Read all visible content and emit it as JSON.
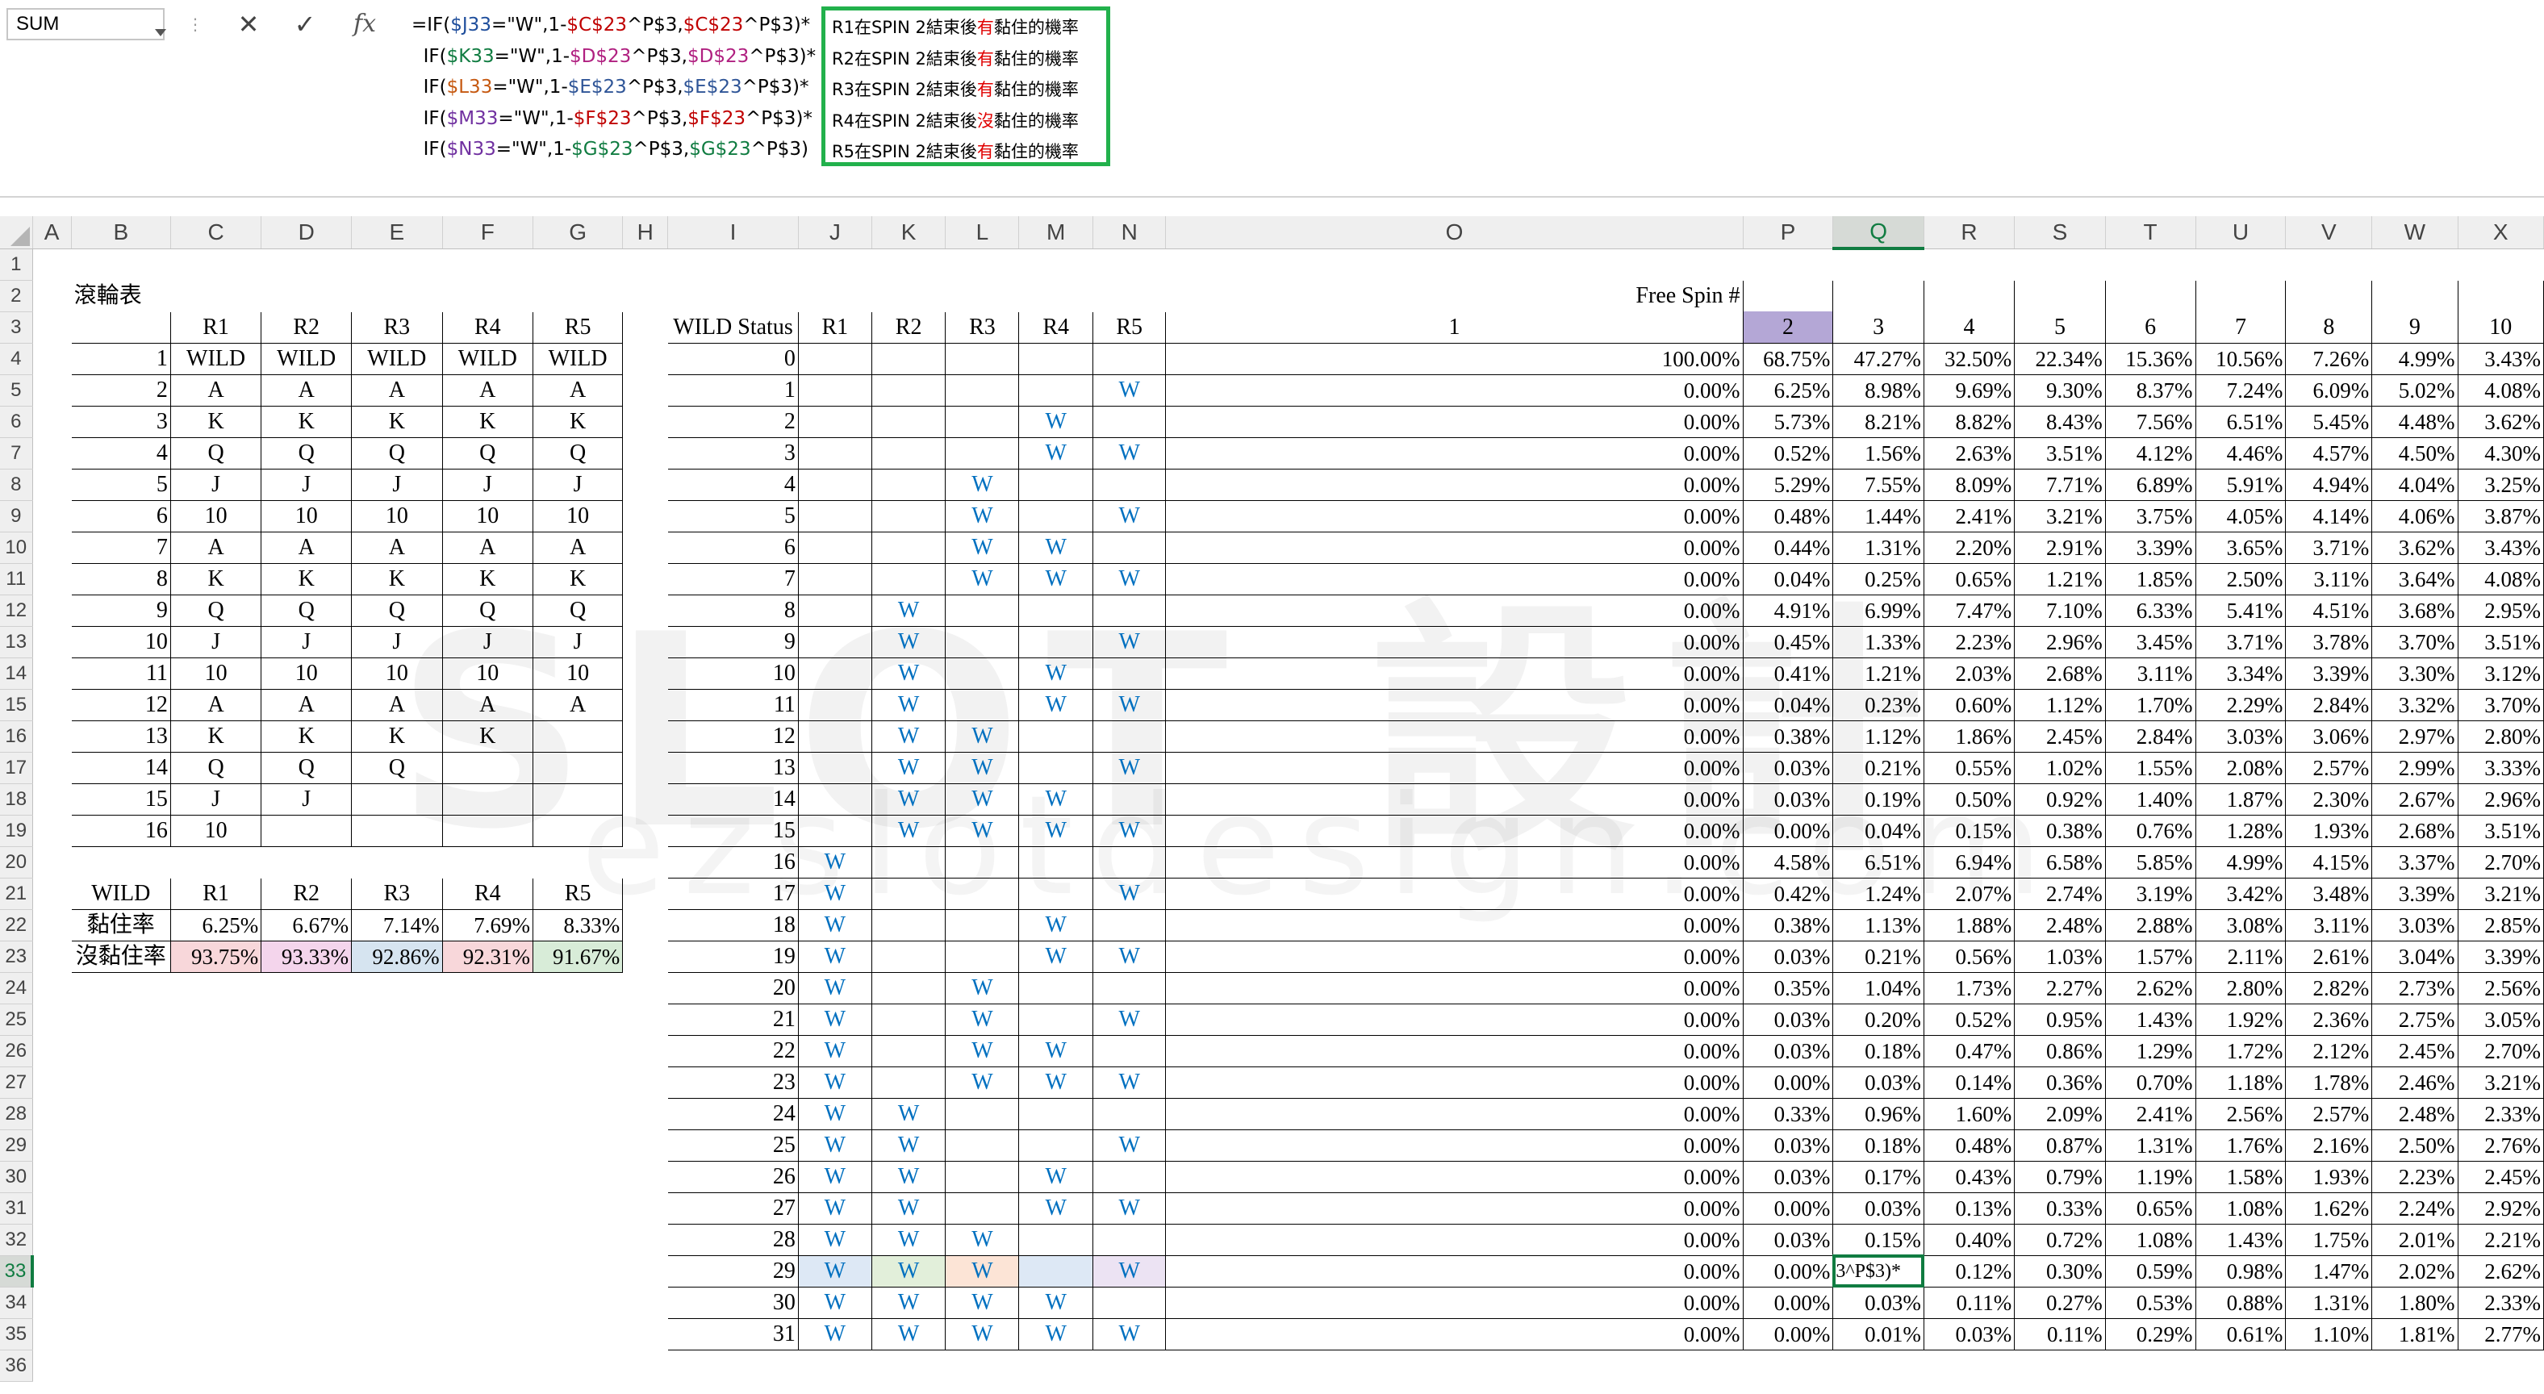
{
  "name_box": "SUM",
  "formula_bar": {
    "cancel_icon": "✕",
    "enter_icon": "✓",
    "fx_label": "fx",
    "lines": [
      [
        [
          "=IF(",
          "#000"
        ],
        [
          "$J33",
          "#1f4e9c"
        ],
        [
          "=\"W\",1-",
          "#000"
        ],
        [
          "$C$23",
          "#c00000"
        ],
        [
          "^P$3,",
          "#000"
        ],
        [
          "$C$23",
          "#c00000"
        ],
        [
          "^P$3)*",
          "#000"
        ]
      ],
      [
        [
          "  IF(",
          "#000"
        ],
        [
          "$K33",
          "#107c41"
        ],
        [
          "=\"W\",1-",
          "#000"
        ],
        [
          "$D$23",
          "#b02080"
        ],
        [
          "^P$3,",
          "#000"
        ],
        [
          "$D$23",
          "#b02080"
        ],
        [
          "^P$3)*",
          "#000"
        ]
      ],
      [
        [
          "  IF(",
          "#000"
        ],
        [
          "$L33",
          "#c65911"
        ],
        [
          "=\"W\",1-",
          "#000"
        ],
        [
          "$E$23",
          "#2f5597"
        ],
        [
          "^P$3,",
          "#000"
        ],
        [
          "$E$23",
          "#2f5597"
        ],
        [
          "^P$3)*",
          "#000"
        ]
      ],
      [
        [
          "  IF(",
          "#000"
        ],
        [
          "$M33",
          "#7030a0"
        ],
        [
          "=\"W\",1-",
          "#000"
        ],
        [
          "$F$23",
          "#c00000"
        ],
        [
          "^P$3,",
          "#000"
        ],
        [
          "$F$23",
          "#c00000"
        ],
        [
          "^P$3)*",
          "#000"
        ]
      ],
      [
        [
          "  IF(",
          "#000"
        ],
        [
          "$N33",
          "#7030a0"
        ],
        [
          "=\"W\",1-",
          "#000"
        ],
        [
          "$G$23",
          "#107c41"
        ],
        [
          "^P$3,",
          "#000"
        ],
        [
          "$G$23",
          "#107c41"
        ],
        [
          "^P$3)",
          "#000"
        ]
      ]
    ],
    "notes": [
      {
        "pre": "R1在SPIN 2結束後",
        "hl": "有",
        "post": "黏住的機率"
      },
      {
        "pre": "R2在SPIN 2結束後",
        "hl": "有",
        "post": "黏住的機率"
      },
      {
        "pre": "R3在SPIN 2結束後",
        "hl": "有",
        "post": "黏住的機率"
      },
      {
        "pre": "R4在SPIN 2結束後",
        "hl": "沒",
        "post": "黏住的機率"
      },
      {
        "pre": "R5在SPIN 2結束後",
        "hl": "有",
        "post": "黏住的機率"
      }
    ]
  },
  "columns": [
    "A",
    "B",
    "C",
    "D",
    "E",
    "F",
    "G",
    "H",
    "I",
    "J",
    "K",
    "L",
    "M",
    "N",
    "O",
    "P",
    "Q",
    "R",
    "S",
    "T",
    "U",
    "V",
    "W",
    "X"
  ],
  "selected_column": "Q",
  "selected_row": 33,
  "reel_table": {
    "title": "滾輪表",
    "headers": [
      "R1",
      "R2",
      "R3",
      "R4",
      "R5"
    ],
    "rows": [
      [
        "1",
        "WILD",
        "WILD",
        "WILD",
        "WILD",
        "WILD"
      ],
      [
        "2",
        "A",
        "A",
        "A",
        "A",
        "A"
      ],
      [
        "3",
        "K",
        "K",
        "K",
        "K",
        "K"
      ],
      [
        "4",
        "Q",
        "Q",
        "Q",
        "Q",
        "Q"
      ],
      [
        "5",
        "J",
        "J",
        "J",
        "J",
        "J"
      ],
      [
        "6",
        "10",
        "10",
        "10",
        "10",
        "10"
      ],
      [
        "7",
        "A",
        "A",
        "A",
        "A",
        "A"
      ],
      [
        "8",
        "K",
        "K",
        "K",
        "K",
        "K"
      ],
      [
        "9",
        "Q",
        "Q",
        "Q",
        "Q",
        "Q"
      ],
      [
        "10",
        "J",
        "J",
        "J",
        "J",
        "J"
      ],
      [
        "11",
        "10",
        "10",
        "10",
        "10",
        "10"
      ],
      [
        "12",
        "A",
        "A",
        "A",
        "A",
        "A"
      ],
      [
        "13",
        "K",
        "K",
        "K",
        "K",
        ""
      ],
      [
        "14",
        "Q",
        "Q",
        "Q",
        "",
        ""
      ],
      [
        "15",
        "J",
        "J",
        "",
        "",
        ""
      ],
      [
        "16",
        "10",
        "",
        "",
        "",
        ""
      ]
    ]
  },
  "wild_table": {
    "headers": [
      "WILD",
      "R1",
      "R2",
      "R3",
      "R4",
      "R5"
    ],
    "sticky_label": "黏住率",
    "sticky": [
      "6.25%",
      "6.67%",
      "7.14%",
      "7.69%",
      "8.33%"
    ],
    "not_sticky_label": "沒黏住率",
    "not_sticky": [
      "93.75%",
      "93.33%",
      "92.86%",
      "92.31%",
      "91.67%"
    ],
    "not_sticky_colors": [
      "#f8d7da",
      "#f4d5ec",
      "#d6e4f0",
      "#f8d7da",
      "#d8ecd8"
    ]
  },
  "wild_status": {
    "header": "WILD Status",
    "reel_headers": [
      "R1",
      "R2",
      "R3",
      "R4",
      "R5"
    ],
    "free_spin_title": "Free Spin #",
    "spins": [
      "1",
      "2",
      "3",
      "4",
      "5",
      "6",
      "7",
      "8",
      "9",
      "10"
    ],
    "selected_spin": "2",
    "row33_colors": [
      "#dde8f5",
      "#e2efda",
      "#fce4d6",
      "#dde8f5",
      "#ece3f3"
    ],
    "editing_text": "3^P$3)*",
    "rows": [
      [
        "0",
        "",
        "",
        "",
        "",
        "",
        "100.00%",
        "68.75%",
        "47.27%",
        "32.50%",
        "22.34%",
        "15.36%",
        "10.56%",
        "7.26%",
        "4.99%",
        "3.43%"
      ],
      [
        "1",
        "",
        "",
        "",
        "",
        "W",
        "0.00%",
        "6.25%",
        "8.98%",
        "9.69%",
        "9.30%",
        "8.37%",
        "7.24%",
        "6.09%",
        "5.02%",
        "4.08%"
      ],
      [
        "2",
        "",
        "",
        "",
        "W",
        "",
        "0.00%",
        "5.73%",
        "8.21%",
        "8.82%",
        "8.43%",
        "7.56%",
        "6.51%",
        "5.45%",
        "4.48%",
        "3.62%"
      ],
      [
        "3",
        "",
        "",
        "",
        "W",
        "W",
        "0.00%",
        "0.52%",
        "1.56%",
        "2.63%",
        "3.51%",
        "4.12%",
        "4.46%",
        "4.57%",
        "4.50%",
        "4.30%"
      ],
      [
        "4",
        "",
        "",
        "W",
        "",
        "",
        "0.00%",
        "5.29%",
        "7.55%",
        "8.09%",
        "7.71%",
        "6.89%",
        "5.91%",
        "4.94%",
        "4.04%",
        "3.25%"
      ],
      [
        "5",
        "",
        "",
        "W",
        "",
        "W",
        "0.00%",
        "0.48%",
        "1.44%",
        "2.41%",
        "3.21%",
        "3.75%",
        "4.05%",
        "4.14%",
        "4.06%",
        "3.87%"
      ],
      [
        "6",
        "",
        "",
        "W",
        "W",
        "",
        "0.00%",
        "0.44%",
        "1.31%",
        "2.20%",
        "2.91%",
        "3.39%",
        "3.65%",
        "3.71%",
        "3.62%",
        "3.43%"
      ],
      [
        "7",
        "",
        "",
        "W",
        "W",
        "W",
        "0.00%",
        "0.04%",
        "0.25%",
        "0.65%",
        "1.21%",
        "1.85%",
        "2.50%",
        "3.11%",
        "3.64%",
        "4.08%"
      ],
      [
        "8",
        "",
        "W",
        "",
        "",
        "",
        "0.00%",
        "4.91%",
        "6.99%",
        "7.47%",
        "7.10%",
        "6.33%",
        "5.41%",
        "4.51%",
        "3.68%",
        "2.95%"
      ],
      [
        "9",
        "",
        "W",
        "",
        "",
        "W",
        "0.00%",
        "0.45%",
        "1.33%",
        "2.23%",
        "2.96%",
        "3.45%",
        "3.71%",
        "3.78%",
        "3.70%",
        "3.51%"
      ],
      [
        "10",
        "",
        "W",
        "",
        "W",
        "",
        "0.00%",
        "0.41%",
        "1.21%",
        "2.03%",
        "2.68%",
        "3.11%",
        "3.34%",
        "3.39%",
        "3.30%",
        "3.12%"
      ],
      [
        "11",
        "",
        "W",
        "",
        "W",
        "W",
        "0.00%",
        "0.04%",
        "0.23%",
        "0.60%",
        "1.12%",
        "1.70%",
        "2.29%",
        "2.84%",
        "3.32%",
        "3.70%"
      ],
      [
        "12",
        "",
        "W",
        "W",
        "",
        "",
        "0.00%",
        "0.38%",
        "1.12%",
        "1.86%",
        "2.45%",
        "2.84%",
        "3.03%",
        "3.06%",
        "2.97%",
        "2.80%"
      ],
      [
        "13",
        "",
        "W",
        "W",
        "",
        "W",
        "0.00%",
        "0.03%",
        "0.21%",
        "0.55%",
        "1.02%",
        "1.55%",
        "2.08%",
        "2.57%",
        "2.99%",
        "3.33%"
      ],
      [
        "14",
        "",
        "W",
        "W",
        "W",
        "",
        "0.00%",
        "0.03%",
        "0.19%",
        "0.50%",
        "0.92%",
        "1.40%",
        "1.87%",
        "2.30%",
        "2.67%",
        "2.96%"
      ],
      [
        "15",
        "",
        "W",
        "W",
        "W",
        "W",
        "0.00%",
        "0.00%",
        "0.04%",
        "0.15%",
        "0.38%",
        "0.76%",
        "1.28%",
        "1.93%",
        "2.68%",
        "3.51%"
      ],
      [
        "16",
        "W",
        "",
        "",
        "",
        "",
        "0.00%",
        "4.58%",
        "6.51%",
        "6.94%",
        "6.58%",
        "5.85%",
        "4.99%",
        "4.15%",
        "3.37%",
        "2.70%"
      ],
      [
        "17",
        "W",
        "",
        "",
        "",
        "W",
        "0.00%",
        "0.42%",
        "1.24%",
        "2.07%",
        "2.74%",
        "3.19%",
        "3.42%",
        "3.48%",
        "3.39%",
        "3.21%"
      ],
      [
        "18",
        "W",
        "",
        "",
        "W",
        "",
        "0.00%",
        "0.38%",
        "1.13%",
        "1.88%",
        "2.48%",
        "2.88%",
        "3.08%",
        "3.11%",
        "3.03%",
        "2.85%"
      ],
      [
        "19",
        "W",
        "",
        "",
        "W",
        "W",
        "0.00%",
        "0.03%",
        "0.21%",
        "0.56%",
        "1.03%",
        "1.57%",
        "2.11%",
        "2.61%",
        "3.04%",
        "3.39%"
      ],
      [
        "20",
        "W",
        "",
        "W",
        "",
        "",
        "0.00%",
        "0.35%",
        "1.04%",
        "1.73%",
        "2.27%",
        "2.62%",
        "2.80%",
        "2.82%",
        "2.73%",
        "2.56%"
      ],
      [
        "21",
        "W",
        "",
        "W",
        "",
        "W",
        "0.00%",
        "0.03%",
        "0.20%",
        "0.52%",
        "0.95%",
        "1.43%",
        "1.92%",
        "2.36%",
        "2.75%",
        "3.05%"
      ],
      [
        "22",
        "W",
        "",
        "W",
        "W",
        "",
        "0.00%",
        "0.03%",
        "0.18%",
        "0.47%",
        "0.86%",
        "1.29%",
        "1.72%",
        "2.12%",
        "2.45%",
        "2.70%"
      ],
      [
        "23",
        "W",
        "",
        "W",
        "W",
        "W",
        "0.00%",
        "0.00%",
        "0.03%",
        "0.14%",
        "0.36%",
        "0.70%",
        "1.18%",
        "1.78%",
        "2.46%",
        "3.21%"
      ],
      [
        "24",
        "W",
        "W",
        "",
        "",
        "",
        "0.00%",
        "0.33%",
        "0.96%",
        "1.60%",
        "2.09%",
        "2.41%",
        "2.56%",
        "2.57%",
        "2.48%",
        "2.33%"
      ],
      [
        "25",
        "W",
        "W",
        "",
        "",
        "W",
        "0.00%",
        "0.03%",
        "0.18%",
        "0.48%",
        "0.87%",
        "1.31%",
        "1.76%",
        "2.16%",
        "2.50%",
        "2.76%"
      ],
      [
        "26",
        "W",
        "W",
        "",
        "W",
        "",
        "0.00%",
        "0.03%",
        "0.17%",
        "0.43%",
        "0.79%",
        "1.19%",
        "1.58%",
        "1.93%",
        "2.23%",
        "2.45%"
      ],
      [
        "27",
        "W",
        "W",
        "",
        "W",
        "W",
        "0.00%",
        "0.00%",
        "0.03%",
        "0.13%",
        "0.33%",
        "0.65%",
        "1.08%",
        "1.62%",
        "2.24%",
        "2.92%"
      ],
      [
        "28",
        "W",
        "W",
        "W",
        "",
        "",
        "0.00%",
        "0.03%",
        "0.15%",
        "0.40%",
        "0.72%",
        "1.08%",
        "1.43%",
        "1.75%",
        "2.01%",
        "2.21%"
      ],
      [
        "29",
        "W",
        "W",
        "W",
        "",
        "W",
        "0.00%",
        "0.00%",
        "",
        "0.12%",
        "0.30%",
        "0.59%",
        "0.98%",
        "1.47%",
        "2.02%",
        "2.62%"
      ],
      [
        "30",
        "W",
        "W",
        "W",
        "W",
        "",
        "0.00%",
        "0.00%",
        "0.03%",
        "0.11%",
        "0.27%",
        "0.53%",
        "0.88%",
        "1.31%",
        "1.80%",
        "2.33%"
      ],
      [
        "31",
        "W",
        "W",
        "W",
        "W",
        "W",
        "0.00%",
        "0.00%",
        "0.01%",
        "0.03%",
        "0.11%",
        "0.29%",
        "0.61%",
        "1.10%",
        "1.81%",
        "2.77%"
      ]
    ]
  },
  "watermark": {
    "top": "SLOT 設計",
    "bottom": "ezslotdesign.com"
  }
}
